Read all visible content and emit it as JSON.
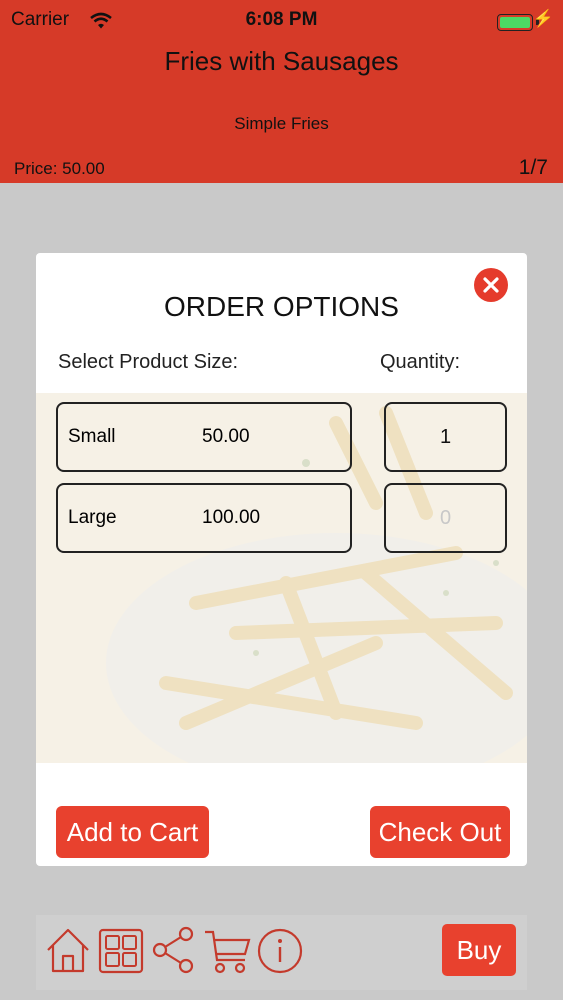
{
  "status_bar": {
    "carrier": "Carrier",
    "time": "6:08 PM"
  },
  "header": {
    "title": "Fries with Sausages",
    "subtitle": "Simple Fries",
    "price": "Price: 50.00",
    "counter": "1/7",
    "color": "#d63a28"
  },
  "modal": {
    "title": "ORDER OPTIONS",
    "size_label": "Select Product Size:",
    "quantity_label": "Quantity:",
    "sizes": [
      {
        "name": "Small",
        "price": "50.00",
        "quantity": "1"
      },
      {
        "name": "Large",
        "price": "100.00",
        "quantity_placeholder": "0"
      }
    ],
    "add_to_cart_label": "Add to Cart",
    "check_out_label": "Check Out",
    "close_icon": "close-icon",
    "accent": "#e8412e"
  },
  "bottom_bar": {
    "icons": [
      "home-icon",
      "grid-icon",
      "share-icon",
      "cart-icon",
      "info-icon"
    ],
    "buy_label": "Buy"
  }
}
